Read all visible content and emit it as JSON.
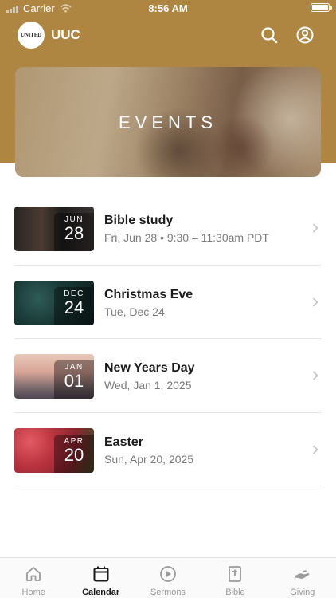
{
  "status_bar": {
    "carrier": "Carrier",
    "time": "8:56 AM"
  },
  "app": {
    "title": "UUC",
    "logo_text": "UNITED"
  },
  "hero": {
    "title": "EVENTS"
  },
  "events": [
    {
      "title": "Bible study",
      "subtitle": "Fri, Jun 28 • 9:30 – 11:30am PDT",
      "month": "JUN",
      "day": "28"
    },
    {
      "title": "Christmas Eve",
      "subtitle": "Tue, Dec 24",
      "month": "DEC",
      "day": "24"
    },
    {
      "title": "New Years Day",
      "subtitle": "Wed, Jan 1, 2025",
      "month": "JAN",
      "day": "01"
    },
    {
      "title": "Easter",
      "subtitle": "Sun, Apr 20, 2025",
      "month": "APR",
      "day": "20"
    }
  ],
  "tabs": [
    {
      "label": "Home",
      "icon": "home-icon",
      "active": false
    },
    {
      "label": "Calendar",
      "icon": "calendar-icon",
      "active": true
    },
    {
      "label": "Sermons",
      "icon": "play-icon",
      "active": false
    },
    {
      "label": "Bible",
      "icon": "bible-icon",
      "active": false
    },
    {
      "label": "Giving",
      "icon": "giving-icon",
      "active": false
    }
  ],
  "colors": {
    "brand": "#ae8641",
    "tab_active": "#1a1a1a",
    "tab_inactive": "#9a9a9a"
  }
}
